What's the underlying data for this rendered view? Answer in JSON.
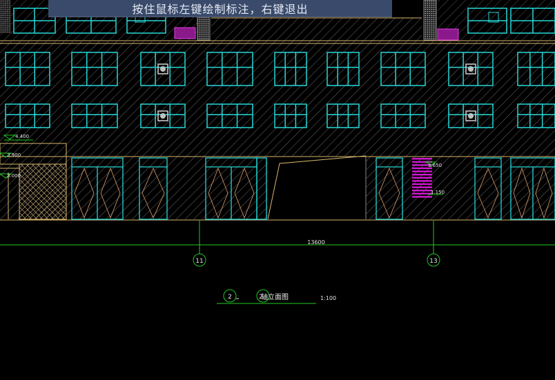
{
  "status_hint": "按住鼠标左键绘制标注，右键退出",
  "dimension_label": "13600",
  "axis_labels": [
    "11",
    "13"
  ],
  "elevation_marks": {
    "left_top": "4.400",
    "left_mid": "3.900",
    "left_low": "3.000",
    "right_top": "3.650",
    "right_low": "1.150"
  },
  "drawing_title": {
    "circle_a": "2",
    "circle_b": "2",
    "text": "轴立面图",
    "scale": "1:100"
  },
  "colors": {
    "background": "#000000",
    "wall_hatch": "#6e6e6e",
    "window": "#27d8d8",
    "floor_line": "#d9b86e",
    "dimension": "#22cc22",
    "highlight": "#d416d4",
    "text": "#e6e6e6"
  }
}
